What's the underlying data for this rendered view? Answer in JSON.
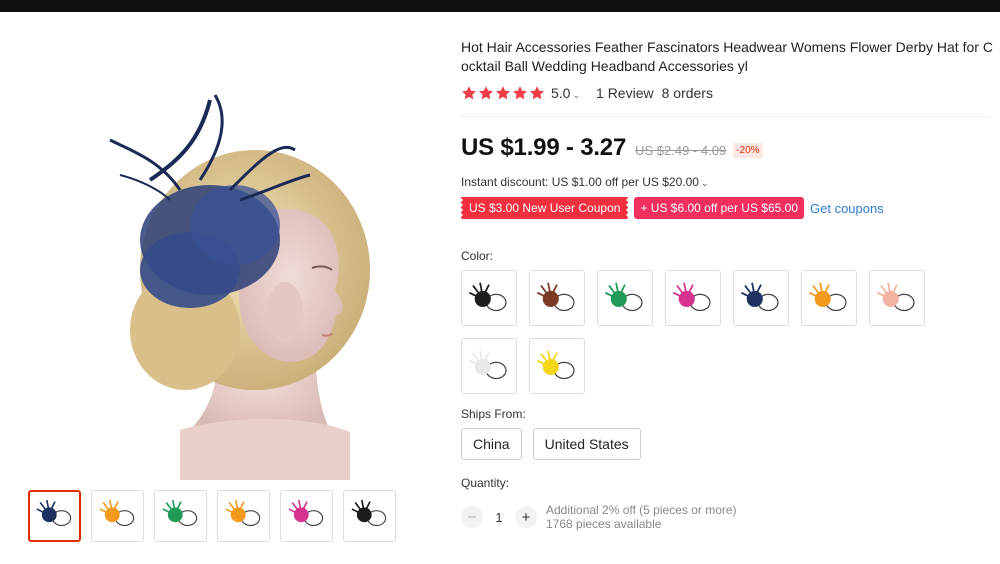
{
  "product": {
    "title": "Hot Hair Accessories Feather Fascinators Headwear Womens Flower Derby Hat for Cocktail Ball Wedding Headband Accessories yl",
    "rating": "5.0",
    "reviews": "1 Review",
    "orders": "8 orders",
    "stars": 5
  },
  "pricing": {
    "price": "US $1.99 - 3.27",
    "old_price": "US $2.49 - 4.09",
    "discount": "-20%",
    "instant_discount": "Instant discount: US $1.00 off per US $20.00"
  },
  "coupons": {
    "new_user": "US $3.00 New User Coupon",
    "store": "US $6.00 off per US $65.00",
    "store_prefix": "+",
    "get": "Get coupons"
  },
  "color": {
    "label": "Color:",
    "options": [
      {
        "name": "black",
        "hex": "#1c1c1c"
      },
      {
        "name": "brown",
        "hex": "#7a3a24"
      },
      {
        "name": "green",
        "hex": "#1f9a57"
      },
      {
        "name": "rose",
        "hex": "#d6338f"
      },
      {
        "name": "navy",
        "hex": "#1e3160"
      },
      {
        "name": "orange",
        "hex": "#f39a1c"
      },
      {
        "name": "pink",
        "hex": "#f2b3a3"
      },
      {
        "name": "white",
        "hex": "#e8e8e8"
      },
      {
        "name": "yellow",
        "hex": "#f3d61a"
      }
    ]
  },
  "ships": {
    "label": "Ships From:",
    "options": [
      "China",
      "United States"
    ]
  },
  "quantity": {
    "label": "Quantity:",
    "value": "1",
    "minus": "−",
    "plus": "+",
    "note1": "Additional 2% off (5 pieces or more)",
    "note2": "1768 pieces available"
  },
  "gallery": {
    "thumb_colors": [
      "#1e3160",
      "#f39a1c",
      "#1f9a57",
      "#f39a1c",
      "#d6338f",
      "#1c1c1c"
    ]
  },
  "colors": {
    "accent": "#e62e04",
    "star": "#f03c46",
    "link": "#2c7bd6"
  }
}
